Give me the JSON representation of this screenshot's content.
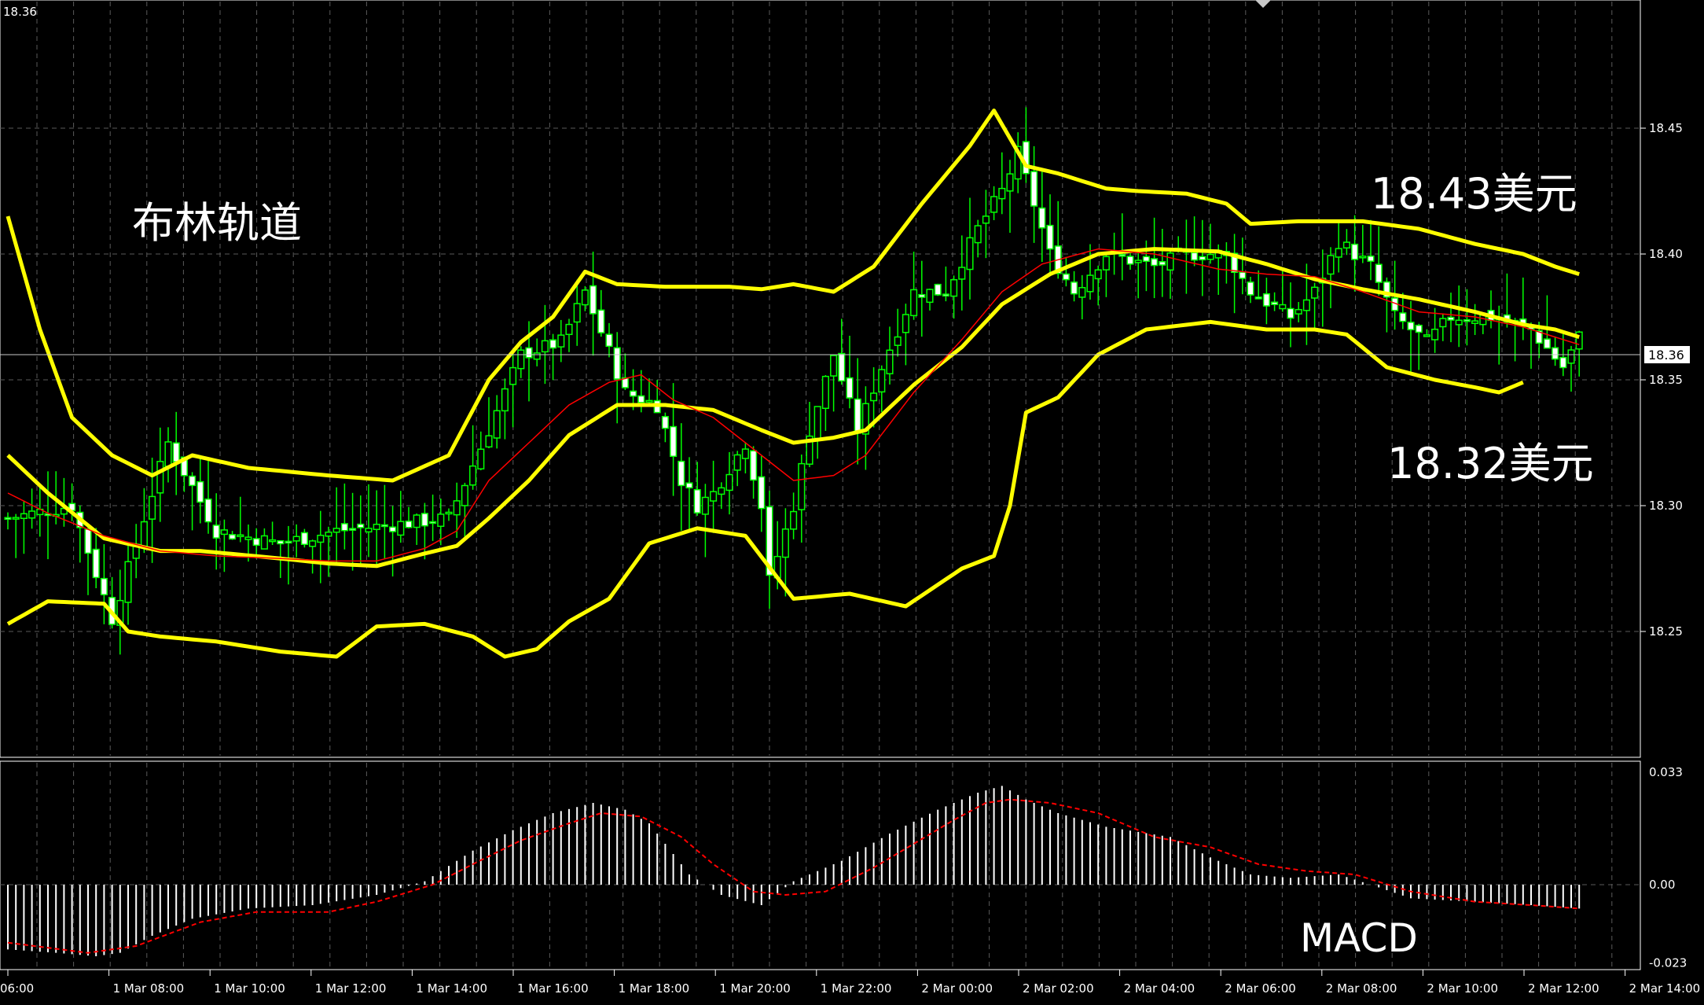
{
  "chart_data": [
    {
      "type": "candlestick",
      "title": "18.36",
      "overlay_label": "布林轨道",
      "annotations": [
        {
          "text": "18.43美元"
        },
        {
          "text": "18.32美元"
        }
      ],
      "ylim": [
        18.2,
        18.5
      ],
      "yticks": [
        "18.45",
        "18.40",
        "18.35",
        "18.30",
        "18.25"
      ],
      "current_price": "18.36",
      "x_labels": [
        "06:00",
        "1 Mar 08:00",
        "1 Mar 10:00",
        "1 Mar 12:00",
        "1 Mar 14:00",
        "1 Mar 16:00",
        "1 Mar 18:00",
        "1 Mar 20:00",
        "1 Mar 22:00",
        "2 Mar 00:00",
        "2 Mar 02:00",
        "2 Mar 04:00",
        "2 Mar 06:00",
        "2 Mar 08:00",
        "2 Mar 10:00",
        "2 Mar 12:00",
        "2 Mar 14:00"
      ],
      "candle_color": "#00ff00",
      "band_color": "#ffff00",
      "ma_color": "#ff0000",
      "close_keypoints": [
        [
          0,
          18.295
        ],
        [
          8,
          18.3
        ],
        [
          13,
          18.255
        ],
        [
          16,
          18.285
        ],
        [
          20,
          18.325
        ],
        [
          26,
          18.29
        ],
        [
          34,
          18.285
        ],
        [
          41,
          18.29
        ],
        [
          47,
          18.292
        ],
        [
          55,
          18.295
        ],
        [
          60,
          18.33
        ],
        [
          64,
          18.36
        ],
        [
          69,
          18.365
        ],
        [
          72,
          18.385
        ],
        [
          77,
          18.345
        ],
        [
          81,
          18.34
        ],
        [
          84,
          18.31
        ],
        [
          86,
          18.3
        ],
        [
          88,
          18.305
        ],
        [
          92,
          18.325
        ],
        [
          94,
          18.3
        ],
        [
          95,
          18.27
        ],
        [
          98,
          18.3
        ],
        [
          100,
          18.33
        ],
        [
          103,
          18.36
        ],
        [
          106,
          18.33
        ],
        [
          109,
          18.355
        ],
        [
          113,
          18.385
        ],
        [
          117,
          18.385
        ],
        [
          121,
          18.41
        ],
        [
          124,
          18.425
        ],
        [
          126,
          18.44
        ],
        [
          128,
          18.42
        ],
        [
          130,
          18.4
        ],
        [
          133,
          18.385
        ],
        [
          137,
          18.4
        ],
        [
          143,
          18.395
        ],
        [
          147,
          18.4
        ],
        [
          152,
          18.4
        ],
        [
          155,
          18.385
        ],
        [
          160,
          18.375
        ],
        [
          163,
          18.385
        ],
        [
          166,
          18.405
        ],
        [
          170,
          18.395
        ],
        [
          173,
          18.375
        ],
        [
          177,
          18.365
        ],
        [
          180,
          18.375
        ],
        [
          185,
          18.375
        ],
        [
          190,
          18.37
        ],
        [
          194,
          18.355
        ],
        [
          196,
          18.367
        ]
      ],
      "bollinger_keypoints": {
        "upper": [
          [
            0,
            18.415
          ],
          [
            4,
            18.37
          ],
          [
            8,
            18.335
          ],
          [
            13,
            18.32
          ],
          [
            18,
            18.312
          ],
          [
            23,
            18.32
          ],
          [
            30,
            18.315
          ],
          [
            40,
            18.312
          ],
          [
            48,
            18.31
          ],
          [
            55,
            18.32
          ],
          [
            60,
            18.35
          ],
          [
            64,
            18.365
          ],
          [
            68,
            18.375
          ],
          [
            72,
            18.393
          ],
          [
            76,
            18.388
          ],
          [
            82,
            18.387
          ],
          [
            90,
            18.387
          ],
          [
            94,
            18.386
          ],
          [
            98,
            18.388
          ],
          [
            103,
            18.385
          ],
          [
            108,
            18.395
          ],
          [
            114,
            18.42
          ],
          [
            120,
            18.443
          ],
          [
            123,
            18.457
          ],
          [
            127,
            18.435
          ],
          [
            131,
            18.432
          ],
          [
            137,
            18.426
          ],
          [
            141,
            18.425
          ],
          [
            147,
            18.424
          ],
          [
            152,
            18.42
          ],
          [
            155,
            18.412
          ],
          [
            161,
            18.413
          ],
          [
            169,
            18.413
          ],
          [
            176,
            18.41
          ],
          [
            183,
            18.404
          ],
          [
            189,
            18.4
          ],
          [
            193,
            18.395
          ],
          [
            196,
            18.392
          ]
        ],
        "middle": [
          [
            0,
            18.32
          ],
          [
            5,
            18.305
          ],
          [
            12,
            18.287
          ],
          [
            19,
            18.282
          ],
          [
            24,
            18.282
          ],
          [
            34,
            18.279
          ],
          [
            40,
            18.277
          ],
          [
            46,
            18.276
          ],
          [
            52,
            18.281
          ],
          [
            56,
            18.284
          ],
          [
            60,
            18.295
          ],
          [
            65,
            18.31
          ],
          [
            70,
            18.328
          ],
          [
            76,
            18.34
          ],
          [
            82,
            18.34
          ],
          [
            88,
            18.338
          ],
          [
            94,
            18.33
          ],
          [
            98,
            18.325
          ],
          [
            103,
            18.327
          ],
          [
            107,
            18.33
          ],
          [
            113,
            18.348
          ],
          [
            119,
            18.363
          ],
          [
            124,
            18.38
          ],
          [
            130,
            18.392
          ],
          [
            136,
            18.4
          ],
          [
            143,
            18.402
          ],
          [
            151,
            18.401
          ],
          [
            157,
            18.396
          ],
          [
            163,
            18.39
          ],
          [
            169,
            18.386
          ],
          [
            176,
            18.382
          ],
          [
            183,
            18.377
          ],
          [
            189,
            18.372
          ],
          [
            193,
            18.37
          ],
          [
            196,
            18.367
          ]
        ],
        "lower": [
          [
            0,
            18.253
          ],
          [
            5,
            18.262
          ],
          [
            12,
            18.261
          ],
          [
            15,
            18.25
          ],
          [
            19,
            18.248
          ],
          [
            26,
            18.246
          ],
          [
            34,
            18.242
          ],
          [
            41,
            18.24
          ],
          [
            46,
            18.252
          ],
          [
            52,
            18.253
          ],
          [
            58,
            18.248
          ],
          [
            62,
            18.24
          ],
          [
            66,
            18.243
          ],
          [
            70,
            18.254
          ],
          [
            75,
            18.263
          ],
          [
            80,
            18.285
          ],
          [
            86,
            18.291
          ],
          [
            92,
            18.288
          ],
          [
            98,
            18.263
          ],
          [
            105,
            18.265
          ],
          [
            112,
            18.26
          ],
          [
            119,
            18.275
          ],
          [
            123,
            18.28
          ],
          [
            125,
            18.3
          ],
          [
            127,
            18.337
          ],
          [
            131,
            18.343
          ],
          [
            136,
            18.36
          ],
          [
            142,
            18.37
          ],
          [
            150,
            18.373
          ],
          [
            157,
            18.37
          ],
          [
            163,
            18.37
          ],
          [
            167,
            18.368
          ],
          [
            172,
            18.355
          ],
          [
            178,
            18.35
          ],
          [
            183,
            18.347
          ],
          [
            186,
            18.345
          ],
          [
            189,
            18.349
          ]
        ],
        "ma": [
          [
            0,
            18.305
          ],
          [
            5,
            18.297
          ],
          [
            12,
            18.288
          ],
          [
            19,
            18.282
          ],
          [
            26,
            18.28
          ],
          [
            34,
            18.279
          ],
          [
            40,
            18.278
          ],
          [
            46,
            18.278
          ],
          [
            52,
            18.283
          ],
          [
            56,
            18.29
          ],
          [
            60,
            18.31
          ],
          [
            64,
            18.322
          ],
          [
            70,
            18.34
          ],
          [
            75,
            18.349
          ],
          [
            79,
            18.352
          ],
          [
            83,
            18.342
          ],
          [
            88,
            18.335
          ],
          [
            94,
            18.32
          ],
          [
            98,
            18.31
          ],
          [
            103,
            18.312
          ],
          [
            107,
            18.32
          ],
          [
            113,
            18.345
          ],
          [
            119,
            18.366
          ],
          [
            124,
            18.385
          ],
          [
            129,
            18.396
          ],
          [
            136,
            18.402
          ],
          [
            143,
            18.4
          ],
          [
            151,
            18.394
          ],
          [
            157,
            18.392
          ],
          [
            163,
            18.391
          ],
          [
            169,
            18.385
          ],
          [
            176,
            18.377
          ],
          [
            183,
            18.375
          ],
          [
            189,
            18.371
          ],
          [
            193,
            18.367
          ],
          [
            196,
            18.364
          ]
        ]
      }
    },
    {
      "type": "bar",
      "title": "MACD",
      "ylim": [
        -0.023,
        0.033
      ],
      "yticks": [
        "0.033",
        "0.00",
        "-0.023"
      ],
      "bar_color": "#ffffff",
      "signal_color": "#ff0000",
      "macd_keypoints": [
        [
          0,
          -0.019
        ],
        [
          6,
          -0.02
        ],
        [
          11,
          -0.021
        ],
        [
          14,
          -0.02
        ],
        [
          18,
          -0.015
        ],
        [
          23,
          -0.01
        ],
        [
          30,
          -0.007
        ],
        [
          38,
          -0.006
        ],
        [
          46,
          -0.003
        ],
        [
          52,
          0.001
        ],
        [
          58,
          0.01
        ],
        [
          63,
          0.016
        ],
        [
          68,
          0.021
        ],
        [
          73,
          0.024
        ],
        [
          77,
          0.022
        ],
        [
          80,
          0.018
        ],
        [
          85,
          0.003
        ],
        [
          89,
          -0.003
        ],
        [
          94,
          -0.006
        ],
        [
          98,
          0.001
        ],
        [
          104,
          0.007
        ],
        [
          110,
          0.015
        ],
        [
          116,
          0.022
        ],
        [
          121,
          0.027
        ],
        [
          124,
          0.029
        ],
        [
          127,
          0.025
        ],
        [
          131,
          0.021
        ],
        [
          137,
          0.017
        ],
        [
          145,
          0.014
        ],
        [
          150,
          0.008
        ],
        [
          155,
          0.003
        ],
        [
          160,
          0.002
        ],
        [
          166,
          0.003
        ],
        [
          170,
          0.0
        ],
        [
          175,
          -0.004
        ],
        [
          183,
          -0.005
        ],
        [
          190,
          -0.006
        ],
        [
          196,
          -0.007
        ]
      ],
      "signal_keypoints": [
        [
          0,
          -0.017
        ],
        [
          10,
          -0.02
        ],
        [
          16,
          -0.018
        ],
        [
          24,
          -0.011
        ],
        [
          31,
          -0.008
        ],
        [
          40,
          -0.008
        ],
        [
          46,
          -0.005
        ],
        [
          53,
          0.0
        ],
        [
          58,
          0.006
        ],
        [
          64,
          0.013
        ],
        [
          70,
          0.018
        ],
        [
          74,
          0.021
        ],
        [
          79,
          0.02
        ],
        [
          84,
          0.014
        ],
        [
          88,
          0.006
        ],
        [
          93,
          -0.002
        ],
        [
          97,
          -0.003
        ],
        [
          102,
          -0.002
        ],
        [
          108,
          0.005
        ],
        [
          113,
          0.012
        ],
        [
          118,
          0.019
        ],
        [
          122,
          0.024
        ],
        [
          125,
          0.025
        ],
        [
          130,
          0.024
        ],
        [
          136,
          0.021
        ],
        [
          143,
          0.014
        ],
        [
          150,
          0.011
        ],
        [
          156,
          0.006
        ],
        [
          162,
          0.004
        ],
        [
          168,
          0.003
        ],
        [
          175,
          -0.002
        ],
        [
          183,
          -0.005
        ],
        [
          190,
          -0.006
        ],
        [
          196,
          -0.007
        ]
      ],
      "signal_label": "MACD"
    }
  ]
}
